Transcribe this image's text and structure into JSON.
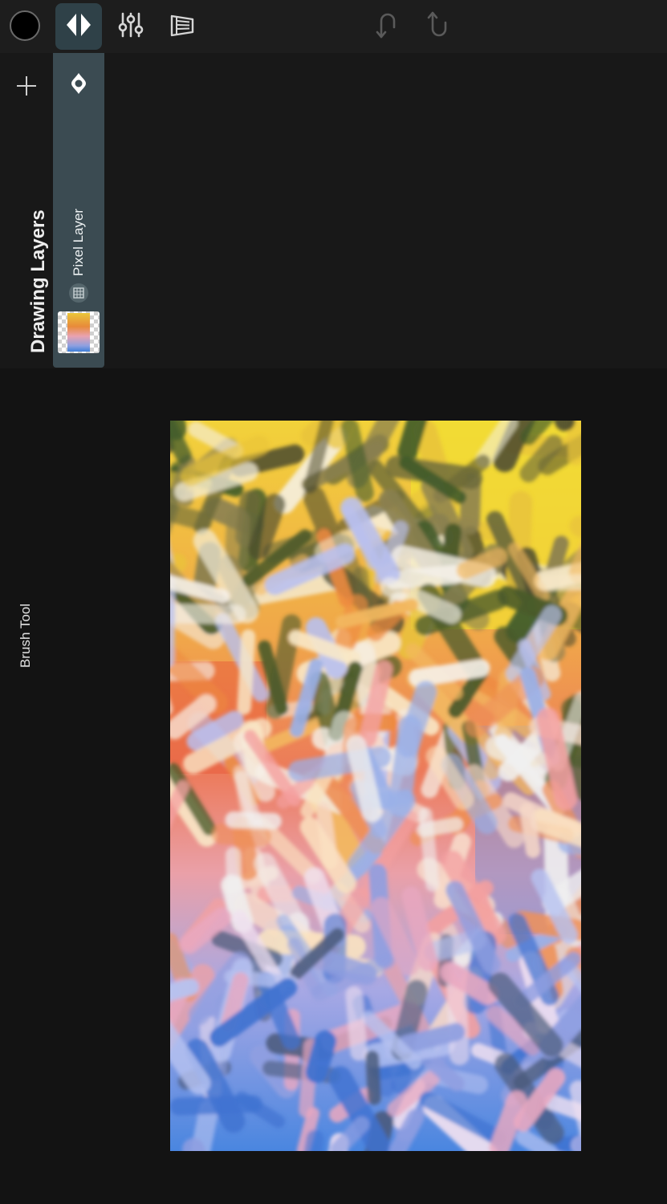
{
  "toolbar": {
    "current_color": "#000000",
    "tools": [
      {
        "name": "layers-tool",
        "icon": "layers-icon",
        "active": true
      },
      {
        "name": "adjustments-tool",
        "icon": "sliders-icon",
        "active": false
      },
      {
        "name": "canvas-tool",
        "icon": "canvas-icon",
        "active": false
      }
    ],
    "undo_icon": "undo-icon",
    "redo_icon": "redo-icon"
  },
  "layers_panel": {
    "title": "Drawing Layers",
    "add_icon": "plus-icon",
    "layers": [
      {
        "name": "Pixel Layer",
        "visibility_icon": "eye-icon",
        "type_icon": "pixel-grid-icon",
        "visible": true
      }
    ]
  },
  "side_panel": {
    "current_tool_label": "Brush Tool"
  },
  "colors": {
    "accent": "#3b4b52",
    "panel_bg": "#181818",
    "topbar_bg": "#1d1d1d",
    "canvas_bg": "#131313"
  }
}
